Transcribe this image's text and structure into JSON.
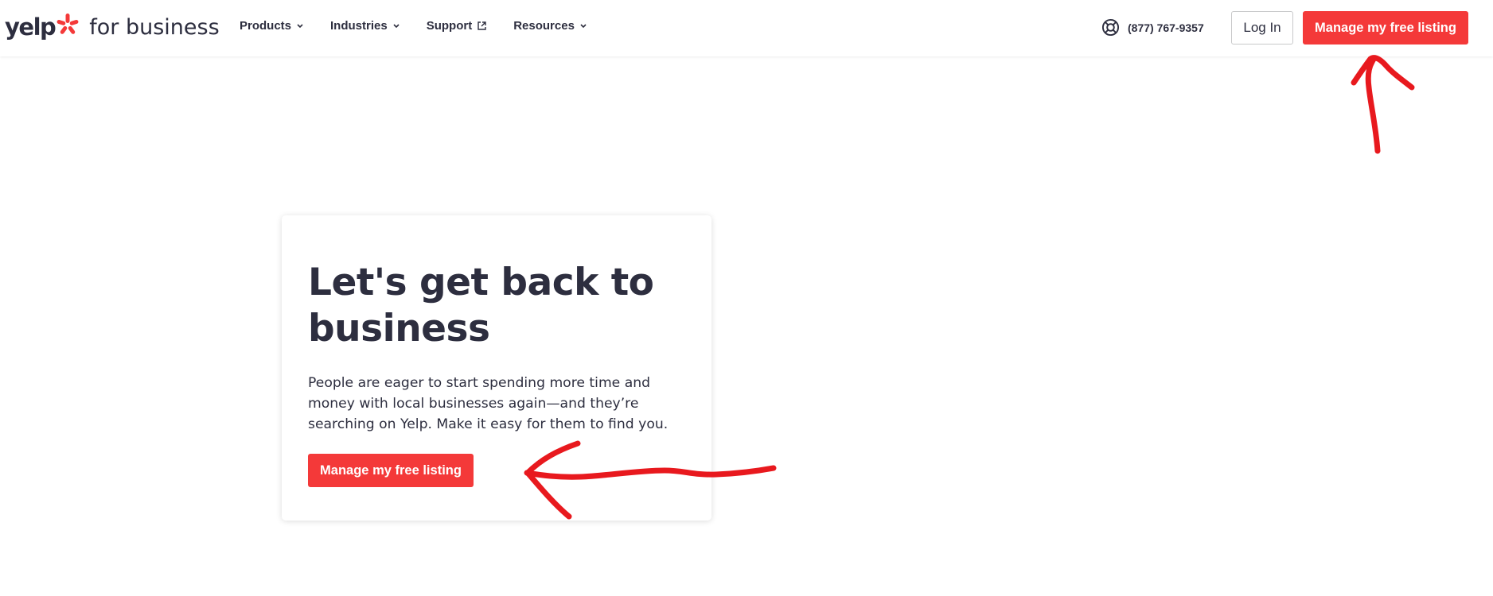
{
  "header": {
    "logo": {
      "wordmark": "yelp",
      "suffix": "for business"
    },
    "nav": [
      {
        "label": "Products",
        "icon": "chevron-down-icon"
      },
      {
        "label": "Industries",
        "icon": "chevron-down-icon"
      },
      {
        "label": "Support",
        "icon": "external-link-icon"
      },
      {
        "label": "Resources",
        "icon": "chevron-down-icon"
      }
    ],
    "phone": {
      "icon": "lifebuoy-icon",
      "number": "(877) 767-9357"
    },
    "login_label": "Log In",
    "cta_label": "Manage my free listing"
  },
  "hero": {
    "title": "Let's get back to business",
    "text": "People are eager to start spending more time and money with local businesses again—and they’re searching on Yelp. Make it easy for them to find you.",
    "cta_label": "Manage my free listing"
  },
  "colors": {
    "brand_red": "#f43939",
    "text_dark": "#2d2e3f",
    "annotation_red": "#e8191e"
  }
}
